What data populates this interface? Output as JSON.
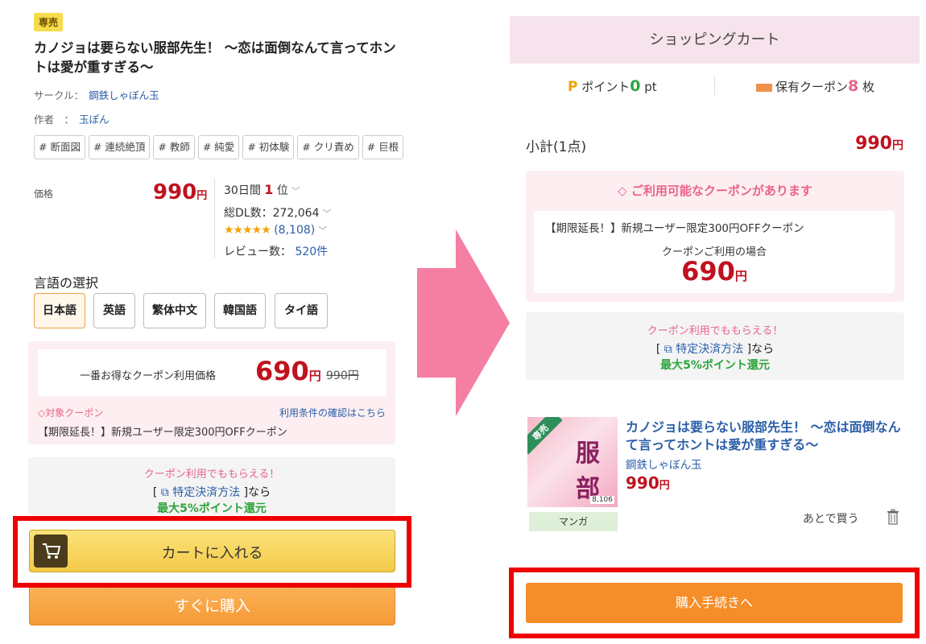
{
  "left": {
    "badge": "専売",
    "title": "カノジョは要らない服部先生！ 〜恋は面倒なんて言ってホントは愛が重すぎる〜",
    "circle_label": "サークル：",
    "circle_value": "鋼鉄しゃぼん玉",
    "author_label": "作者　：",
    "author_value": "玉ぽん",
    "tags": [
      "# 断面図",
      "# 連続絶頂",
      "# 教師",
      "# 純愛",
      "# 初体験",
      "# クリ責め",
      "# 巨根"
    ],
    "price_label": "価格",
    "price": "990",
    "yen": "円",
    "rank_prefix": "30日間",
    "rank_value": "1",
    "rank_suffix": "位",
    "downloads": "総DL数：272,064",
    "rating_stars": "★★★★★",
    "rating_count": "(8,108)",
    "review_label": "レビュー数：",
    "review_count": "520件",
    "language_heading": "言語の選択",
    "languages": [
      "日本語",
      "英語",
      "繁体中文",
      "韓国語",
      "タイ語"
    ],
    "best_price_label": "一番お得なクーポン利用価格",
    "best_price": "690",
    "original_price": "990円",
    "target_coupon": "対象クーポン",
    "terms_link": "利用条件の確認はこちら",
    "coupon_name": "【期限延長！】新規ユーザー限定300円OFFクーポン",
    "points_promo": "クーポン利用でももらえる！",
    "payment_open": "[",
    "payment_link": "特定決済方法",
    "payment_close": "]なら",
    "points_max": "最大5%ポイント還元",
    "add_to_cart": "カートに入れる",
    "buy_now": "すぐに購入"
  },
  "right": {
    "header": "ショッピングカート",
    "point_icon": "P",
    "point_label": "ポイント",
    "point_value": "0",
    "point_unit": "pt",
    "coupon_label": "保有クーポン",
    "coupon_value": "8",
    "coupon_unit": "枚",
    "subtotal_label": "小計(1点)",
    "subtotal_value": "990",
    "yen": "円",
    "available_title": "ご利用可能なクーポンがあります",
    "available_coupon_name": "【期限延長！】新規ユーザー限定300円OFFクーポン",
    "available_case": "クーポンご利用の場合",
    "available_price": "690",
    "points_promo": "クーポン利用でももらえる！",
    "payment_open": "[",
    "payment_link": "特定決済方法",
    "payment_close": "]なら",
    "points_max": "最大5%ポイント還元",
    "thumb_badge": "専売",
    "thumb_title": "服部",
    "thumb_count": "8,106",
    "item_category": "マンガ",
    "item_title": "カノジョは要らない服部先生！ 〜恋は面倒なんて言ってホントは愛が重すぎる〜",
    "item_circle": "鋼鉄しゃぼん玉",
    "item_price": "990",
    "later": "あとで買う",
    "proceed": "購入手続きへ"
  },
  "colors": {
    "price_red": "#c0111f",
    "link_blue": "#2a5ea8",
    "promo_pink": "#e8638a",
    "points_green": "#2ea43c",
    "cart_yellow": "#f4c949",
    "buy_orange": "#f59a35",
    "proceed_orange": "#f58d28",
    "highlight_red": "#ee0000",
    "arrow_pink": "#f47fa3"
  }
}
